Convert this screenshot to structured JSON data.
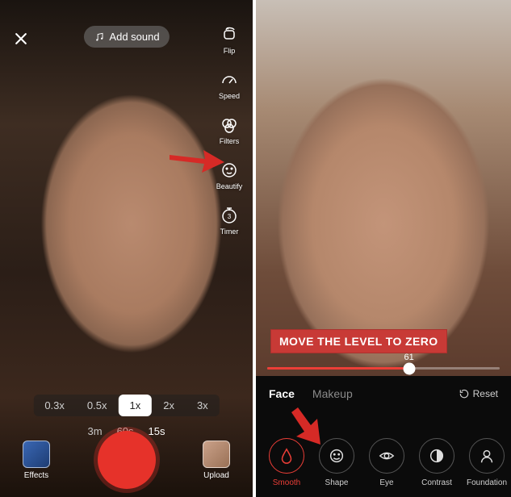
{
  "left": {
    "add_sound_label": "Add sound",
    "tools": {
      "flip": "Flip",
      "speed": "Speed",
      "filters": "Filters",
      "beautify": "Beautify",
      "timer": "Timer"
    },
    "speed_options": [
      "0.3x",
      "0.5x",
      "1x",
      "2x",
      "3x"
    ],
    "speed_active_index": 2,
    "duration_options": [
      "3m",
      "60s",
      "15s"
    ],
    "duration_active_index": 2,
    "effects_label": "Effects",
    "upload_label": "Upload"
  },
  "right": {
    "slider": {
      "value": 61,
      "max": 100
    },
    "callout_text": "MOVE THE LEVEL TO ZERO",
    "tabs": {
      "face": "Face",
      "makeup": "Makeup",
      "active": "face"
    },
    "reset_label": "Reset",
    "options": [
      {
        "key": "smooth",
        "label": "Smooth"
      },
      {
        "key": "shape",
        "label": "Shape"
      },
      {
        "key": "eye",
        "label": "Eye"
      },
      {
        "key": "contrast",
        "label": "Contrast"
      },
      {
        "key": "foundation",
        "label": "Foundation"
      }
    ],
    "active_option": "smooth"
  },
  "colors": {
    "accent_red": "#ec3e37",
    "annotation_red": "#d62a26"
  }
}
